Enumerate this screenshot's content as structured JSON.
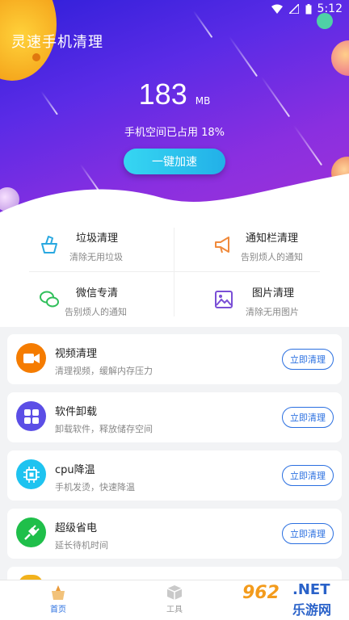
{
  "status": {
    "time": "5:12"
  },
  "app": {
    "title": "灵速手机清理"
  },
  "storage": {
    "value": "183",
    "unit": "MB",
    "usage_text": "手机空间已占用 18%"
  },
  "boost_button": "一键加速",
  "quick_actions": [
    {
      "title": "垃圾清理",
      "subtitle": "清除无用垃圾",
      "icon": "basket-icon"
    },
    {
      "title": "通知栏清理",
      "subtitle": "告别烦人的通知",
      "icon": "megaphone-icon"
    },
    {
      "title": "微信专清",
      "subtitle": "告别烦人的通知",
      "icon": "wechat-icon"
    },
    {
      "title": "图片清理",
      "subtitle": "清除无用图片",
      "icon": "picture-icon"
    }
  ],
  "features": [
    {
      "title": "视频清理",
      "subtitle": "清理视频，缓解内存压力",
      "button": "立即清理",
      "color": "#f57c00",
      "icon": "video-camera-icon"
    },
    {
      "title": "软件卸载",
      "subtitle": "卸载软件，释放储存空间",
      "button": "立即清理",
      "color": "#5b4ee6",
      "icon": "apps-grid-icon"
    },
    {
      "title": "cpu降温",
      "subtitle": "手机发烫，快速降温",
      "button": "立即清理",
      "color": "#1ec3f0",
      "icon": "cpu-chip-icon"
    },
    {
      "title": "超级省电",
      "subtitle": "延长待机时间",
      "button": "立即清理",
      "color": "#1fbf4a",
      "icon": "plug-icon"
    }
  ],
  "tabs": [
    {
      "label": "首页",
      "icon": "home-clean-icon",
      "active": true
    },
    {
      "label": "工具",
      "icon": "toolbox-icon",
      "active": false
    }
  ],
  "watermark": {
    "number": "962",
    "net": ".NET",
    "sub": "乐游网"
  },
  "colors": {
    "accent": "#2a6fe0",
    "hero_start": "#2f1fd9",
    "hero_end": "#a032d6",
    "boost_button": "#2bc4ee"
  }
}
